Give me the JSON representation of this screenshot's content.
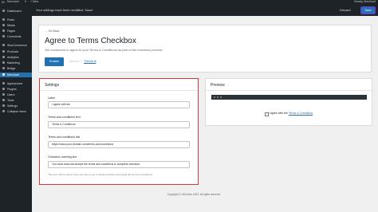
{
  "adminbar": {
    "logo": "W",
    "site": "Merchant",
    "comments": "0",
    "new": "+ New",
    "howdy": "Howdy, Merchant"
  },
  "sidebar": {
    "items": [
      {
        "label": "Dashboard",
        "icon": "dashboard-icon"
      },
      {
        "label": "Posts",
        "icon": "pin-icon"
      },
      {
        "label": "Media",
        "icon": "media-icon"
      },
      {
        "label": "Pages",
        "icon": "page-icon"
      },
      {
        "label": "Comments",
        "icon": "comment-icon"
      },
      {
        "label": "WooCommerce",
        "icon": "woo-icon"
      },
      {
        "label": "Products",
        "icon": "box-icon"
      },
      {
        "label": "Analytics",
        "icon": "chart-icon"
      },
      {
        "label": "Marketing",
        "icon": "megaphone-icon"
      },
      {
        "label": "Bridge",
        "icon": "bridge-icon"
      },
      {
        "label": "Merchant",
        "icon": "merchant-icon"
      },
      {
        "label": "Appearance",
        "icon": "brush-icon"
      },
      {
        "label": "Plugins",
        "icon": "plugin-icon"
      },
      {
        "label": "Users",
        "icon": "user-icon"
      },
      {
        "label": "Tools",
        "icon": "wrench-icon"
      },
      {
        "label": "Settings",
        "icon": "settings-icon"
      },
      {
        "label": "Collapse menu",
        "icon": "collapse-icon"
      }
    ]
  },
  "topbar": {
    "message": "Your settings have been modified. Save!",
    "discard": "Discard",
    "save": "Save"
  },
  "header": {
    "back": "← Go Back",
    "title": "Agree to Terms Checkbox",
    "subtitle": "Get customers to agree to your Terms & Conditions as part of the checkout process",
    "enable": "Enable",
    "manual": "Manual ⓘ",
    "tutorial": "Tutorial ⧉"
  },
  "settings": {
    "heading": "Settings",
    "fields": [
      {
        "label": "Label",
        "value": "I agree with the"
      },
      {
        "label": "Terms and conditions text",
        "value": "Terms & Conditions"
      },
      {
        "label": "Terms and conditions link",
        "value": "https://www.your-domain.com/terms-and-conditions"
      },
      {
        "label": "Checkbox warning text",
        "value": "You must read and accept the terms and conditions to complete checkout."
      }
    ],
    "note": "The error will be shown if the user tries to go to checkout without accepting the Terms & Conditions."
  },
  "preview": {
    "heading": "Preview",
    "label": "I agree with the",
    "link": "Terms & Conditions"
  },
  "footer": {
    "text": "Copyright © aThemes 2023. All rights reserved."
  },
  "colors": {
    "accent": "#2271b1",
    "sidebar": "#1d2327",
    "highlight": "#d63638"
  }
}
